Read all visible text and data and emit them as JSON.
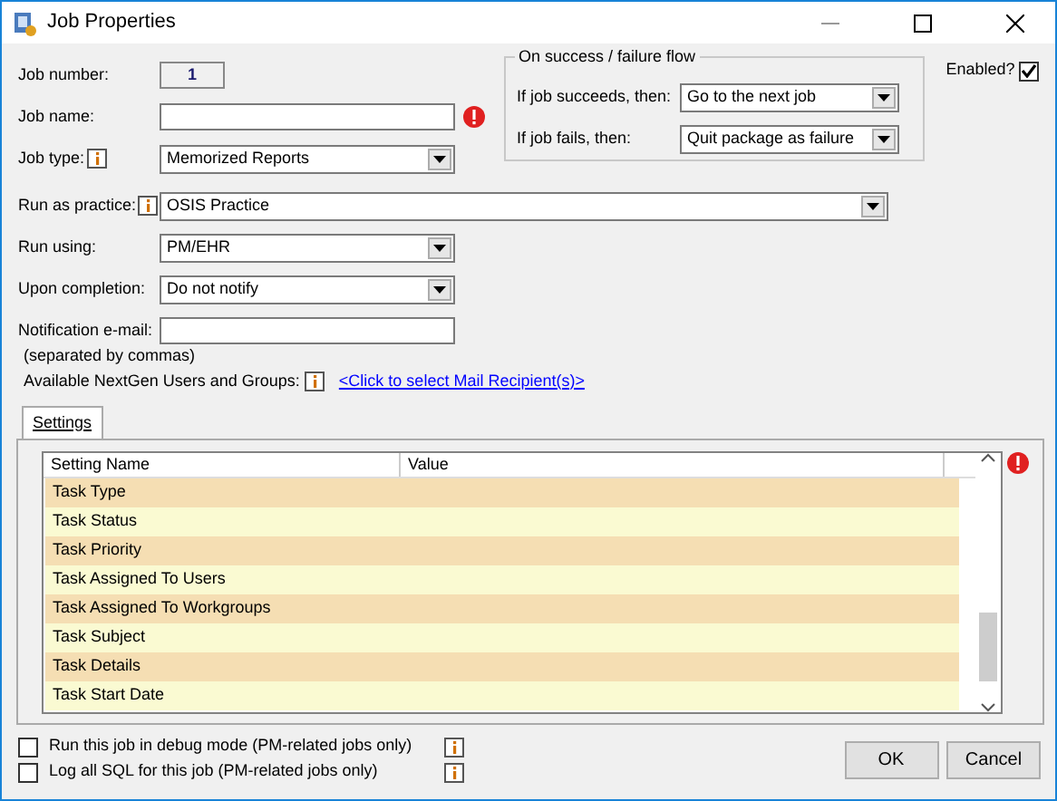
{
  "window": {
    "title": "Job Properties"
  },
  "job_number": {
    "label": "Job number:",
    "value": "1"
  },
  "job_name": {
    "label": "Job name:",
    "error": true
  },
  "job_type": {
    "label": "Job type:",
    "value": "Memorized Reports"
  },
  "flow": {
    "title": "On success / failure flow",
    "fields": [
      {
        "label": "If job succeeds, then:",
        "value": "Go to the next job"
      },
      {
        "label": "If job fails, then:",
        "value": "Quit package as failure"
      }
    ]
  },
  "enabled": {
    "label": "Enabled?",
    "checked": true
  },
  "run_as_practice": {
    "label": "Run as practice:",
    "value": "OSIS Practice"
  },
  "run_using": {
    "label": "Run using:",
    "value": "PM/EHR"
  },
  "upon_completion": {
    "label": "Upon completion:",
    "value": "Do not notify"
  },
  "notification_email": {
    "label": "Notification e-mail:",
    "hint": "(separated by commas)"
  },
  "recipients": {
    "label": "Available NextGen Users and Groups:",
    "link": "<Click to select Mail Recipient(s)>"
  },
  "tabs": [
    {
      "label": "Settings",
      "selected": true
    }
  ],
  "settings_table": {
    "columns": [
      "Setting Name",
      "Value"
    ],
    "error": true,
    "rows": [
      {
        "name": "Task Type"
      },
      {
        "name": "Task Status"
      },
      {
        "name": "Task Priority"
      },
      {
        "name": "Task Assigned To Users"
      },
      {
        "name": "Task Assigned To Workgroups"
      },
      {
        "name": "Task Subject"
      },
      {
        "name": "Task Details"
      },
      {
        "name": "Task Start Date"
      }
    ]
  },
  "options": [
    {
      "label": "Run this job in debug mode (PM-related jobs only)",
      "checked": false
    },
    {
      "label": "Log all SQL for this job (PM-related jobs only)",
      "checked": false
    }
  ],
  "buttons": [
    "OK",
    "Cancel"
  ]
}
